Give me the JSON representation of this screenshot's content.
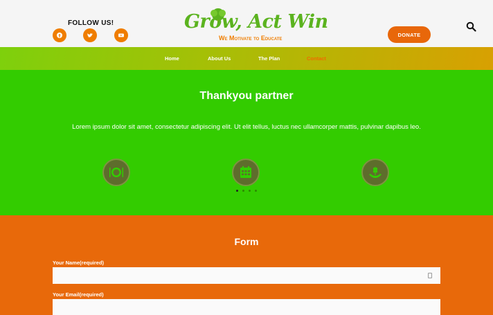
{
  "header": {
    "follow_label": "FOLLOW US!",
    "logo_text": "Grow, Act Win",
    "logo_tagline": "We Motivate to Educate",
    "donate_label": "DONATE"
  },
  "nav": {
    "items": [
      "Home",
      "About Us",
      "The Plan",
      "Contact"
    ]
  },
  "partner": {
    "title": "Thankyou partner",
    "text": "Lorem ipsum dolor sit amet, consectetur adipiscing elit. Ut elit tellus, luctus nec ullamcorper mattis, pulvinar dapibus leo.",
    "icons": [
      "plate-icon",
      "calendar-icon",
      "wheat-hand-icon"
    ],
    "slides": 4,
    "active_slide": 1
  },
  "form": {
    "title": "Form",
    "name_label": "Your Name(required)",
    "email_label": "Your Email(required)",
    "name_value": "",
    "email_value": ""
  },
  "colors": {
    "green": "#33cc00",
    "orange": "#e8690a",
    "accent": "#ef7d00"
  }
}
